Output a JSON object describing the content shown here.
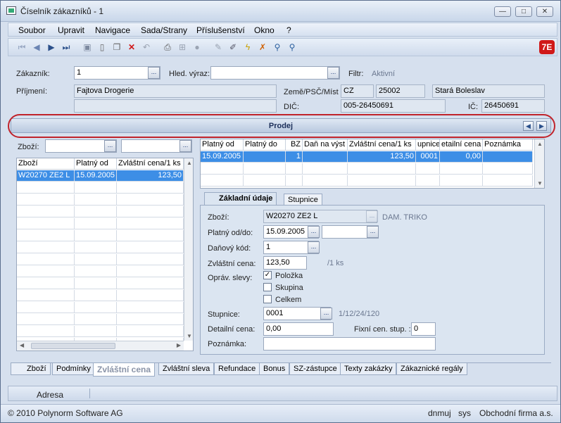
{
  "window": {
    "title": "Číselník zákazníků - 1"
  },
  "menu": [
    "Soubor",
    "Upravit",
    "Navigace",
    "Sada/Strany",
    "Příslušenství",
    "Okno",
    "?"
  ],
  "toolbar_icons": [
    "first-icon",
    "prev-icon",
    "next-icon",
    "last-icon",
    "save-icon",
    "new-icon",
    "copy-icon",
    "delete-icon",
    "undo-icon",
    "print-icon",
    "tree-icon",
    "disabled-icon",
    "pen-icon",
    "edit-icon",
    "wand-icon",
    "clear-filter-icon",
    "search-icon",
    "search-advanced-icon"
  ],
  "header": {
    "customer_label": "Zákazník:",
    "customer_value": "1",
    "search_label": "Hled. výraz:",
    "search_value": "",
    "filter_label": "Filtr:",
    "filter_value": "Aktivní",
    "surname_label": "Příjmení:",
    "surname_value": "Fajtova Drogerie",
    "surname_value2": "",
    "country_label": "Země/PSČ/Míst",
    "country_value": "CZ",
    "zip_value": "25002",
    "city_value": "Stará Boleslav",
    "dic_label": "DIČ:",
    "dic_value": "005-26450691",
    "ic_label": "IČ:",
    "ic_value": "26450691"
  },
  "section": {
    "title": "Prodej"
  },
  "left_panel": {
    "goods_label": "Zboží:",
    "goods_value1": "",
    "goods_value2": "",
    "columns": [
      "Zboží",
      "Platný od",
      "Zvláštní cena/1 ks"
    ],
    "rows": [
      {
        "item": "W20270 ZE2 L",
        "valid_from": "15.09.2005",
        "price": "123,50"
      }
    ]
  },
  "right_grid": {
    "columns": [
      "Platný od",
      "Platný do",
      "BZ",
      "Daň na výst",
      "Zvláštní cena/1 ks",
      "upnice",
      "etailní cena",
      "Poznámka"
    ],
    "rows": [
      {
        "valid_from": "15.09.2005",
        "valid_to": "",
        "bz": "1",
        "tax": "",
        "price": "123,50",
        "scale": "0001",
        "detail": "0,00",
        "note": ""
      }
    ]
  },
  "tabs": [
    "Základní údaje",
    "Stupnice"
  ],
  "form": {
    "goods_label": "Zboží:",
    "goods_value": "W20270 ZE2 L",
    "goods_desc": "DAM. TRIKO",
    "valid_label": "Platný od/do:",
    "valid_from": "15.09.2005",
    "valid_to": "",
    "tax_label": "Daňový kód:",
    "tax_value": "1",
    "price_label": "Zvláštní cena:",
    "price_value": "123,50",
    "price_unit": "/1 ks",
    "discount_label": "Opráv. slevy:",
    "discount_options": [
      {
        "label": "Položka",
        "checked": true
      },
      {
        "label": "Skupina",
        "checked": false
      },
      {
        "label": "Celkem",
        "checked": false
      }
    ],
    "scale_label": "Stupnice:",
    "scale_value": "0001",
    "scale_desc": "1/12/24/120",
    "detail_label": "Detailní cena:",
    "detail_value": "0,00",
    "fixed_label": "Fixní cen. stup. :",
    "fixed_value": "0",
    "note_label": "Poznámka:",
    "note_value": ""
  },
  "bottom_tabs": [
    "Zboží",
    "Podmínky",
    "Zvláštní cena",
    "Zvláštní sleva",
    "Refundace",
    "Bonus",
    "SZ-zástupce",
    "Texty zakázky",
    "Zákaznické regály"
  ],
  "bottom_active": "Zvláštní cena",
  "footer": {
    "address_label": "Adresa"
  },
  "status": {
    "copyright": "© 2010 Polynorm Software AG",
    "user": "dnmuj",
    "system": "sys",
    "company": "Obchodní firma a.s."
  }
}
